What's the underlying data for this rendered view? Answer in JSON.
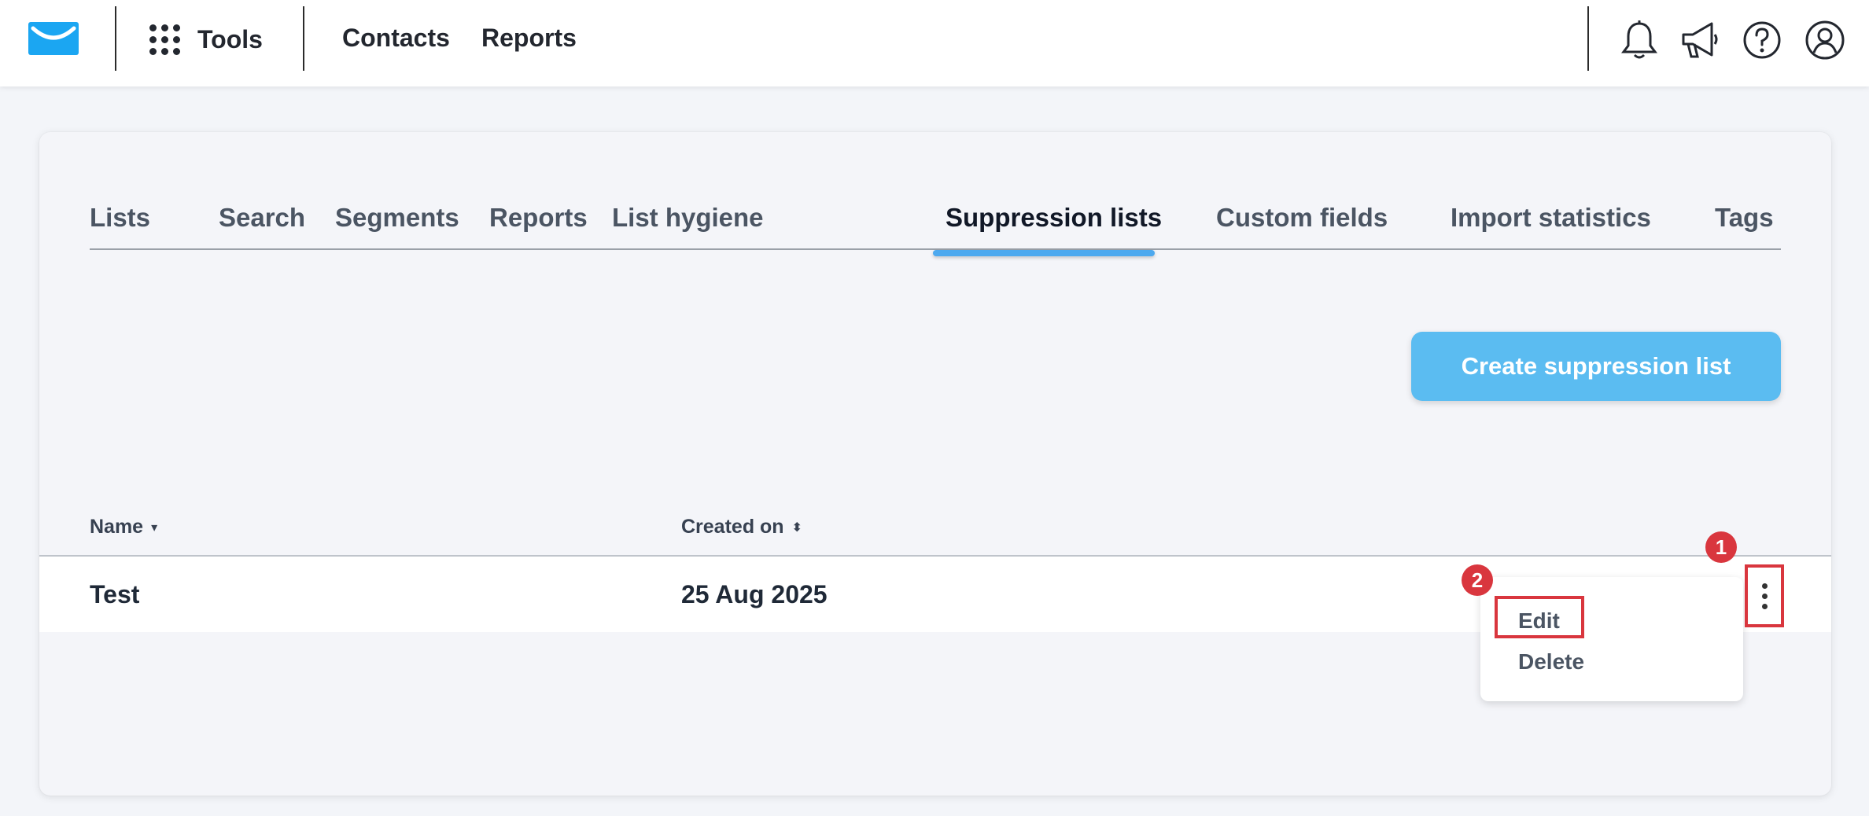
{
  "topbar": {
    "tools_label": "Tools",
    "nav": [
      "Contacts",
      "Reports"
    ],
    "icons": [
      "logo-envelope-icon",
      "apps-grid-icon",
      "bell-icon",
      "megaphone-icon",
      "help-icon",
      "user-icon"
    ],
    "brand_color": "#1ba6f2"
  },
  "tabs": [
    {
      "label": "Lists",
      "active": false
    },
    {
      "label": "Search",
      "active": false
    },
    {
      "label": "Segments",
      "active": false
    },
    {
      "label": "Reports",
      "active": false
    },
    {
      "label": "List hygiene",
      "active": false
    },
    {
      "label": "Suppression lists",
      "active": true
    },
    {
      "label": "Custom fields",
      "active": false
    },
    {
      "label": "Import statistics",
      "active": false
    },
    {
      "label": "Tags",
      "active": false
    }
  ],
  "actions": {
    "create_label": "Create suppression list",
    "accent_color": "#5bbcf1"
  },
  "table": {
    "columns": [
      {
        "label": "Name",
        "sort": "▾"
      },
      {
        "label": "Created on",
        "sort": "⬍"
      }
    ],
    "rows": [
      {
        "name": "Test",
        "created_on": "25 Aug 2025"
      }
    ]
  },
  "row_menu": {
    "items": [
      "Edit",
      "Delete"
    ]
  },
  "annotations": {
    "badges": [
      "1",
      "2"
    ],
    "color": "#d9363e"
  }
}
